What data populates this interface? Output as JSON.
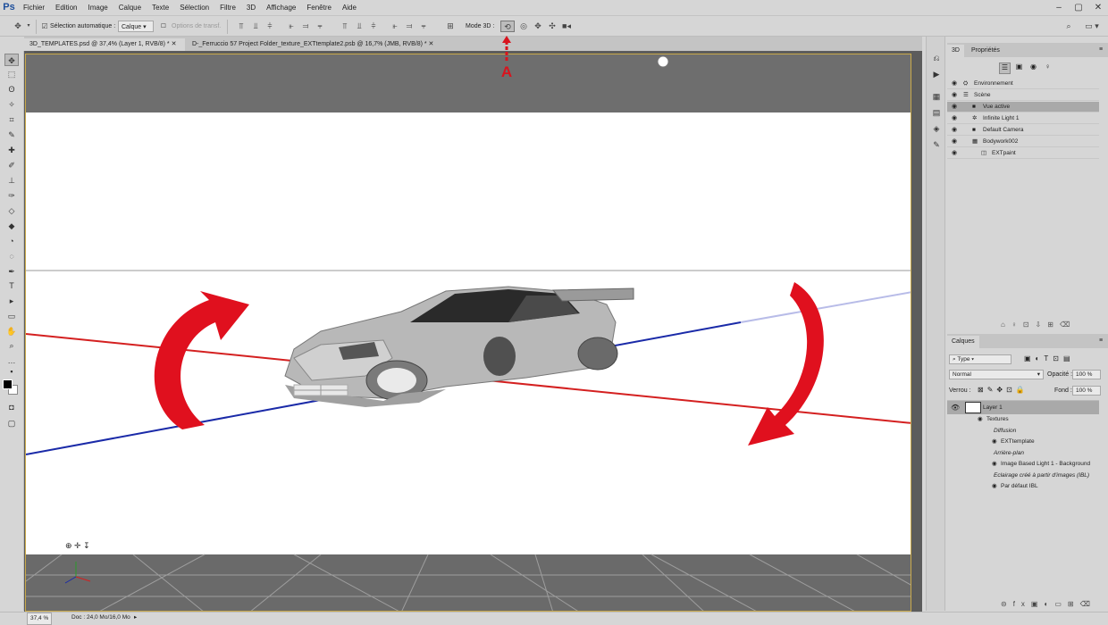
{
  "app": {
    "logo": "Ps"
  },
  "menu": [
    "Fichier",
    "Edition",
    "Image",
    "Calque",
    "Texte",
    "Sélection",
    "Filtre",
    "3D",
    "Affichage",
    "Fenêtre",
    "Aide"
  ],
  "options_bar": {
    "auto_select_label": "Sélection automatique :",
    "auto_select_value": "Calque",
    "transform_options": "Options de transf.",
    "mode3d_label": "Mode 3D :"
  },
  "tabs": [
    "3D_TEMPLATES.psd @ 37,4% (Layer 1, RVB/8) *",
    "D-_Ferruccio 57 Project Folder_texture_EXTtemplate2.psb @ 16,7% (JMB, RVB/8) *"
  ],
  "annotation": {
    "label": "A",
    "color": "#d8141e"
  },
  "colors": {
    "arrow": "#e0101e",
    "x_axis": "#d42020",
    "z_axis": "#1a2aa8"
  },
  "panel3d": {
    "tabs": [
      "3D",
      "Propriétés"
    ],
    "items": [
      {
        "label": "Environnement",
        "icon": "environment-icon",
        "indent": 0,
        "selected": false
      },
      {
        "label": "Scène",
        "icon": "scene-icon",
        "indent": 0,
        "selected": false
      },
      {
        "label": "Vue active",
        "icon": "camera-icon",
        "indent": 1,
        "selected": true
      },
      {
        "label": "Infinite Light 1",
        "icon": "light-icon",
        "indent": 1,
        "selected": false
      },
      {
        "label": "Default Camera",
        "icon": "camera-icon",
        "indent": 1,
        "selected": false
      },
      {
        "label": "Bodywork002",
        "icon": "mesh-icon",
        "indent": 1,
        "selected": false
      },
      {
        "label": "EXTpaint",
        "icon": "material-icon",
        "indent": 2,
        "selected": false
      }
    ]
  },
  "layers_panel": {
    "title": "Calques",
    "filter_type": "Type",
    "blend_mode": "Normal",
    "opacity_label": "Opacité :",
    "opacity_value": "100 %",
    "lock_label": "Verrou :",
    "fill_label": "Fond :",
    "fill_value": "100 %",
    "layer_name": "Layer 1",
    "sublayers": [
      {
        "text": "Textures",
        "eye": true,
        "italic": false,
        "indent": 0
      },
      {
        "text": "Diffusion",
        "eye": false,
        "italic": true,
        "indent": 1
      },
      {
        "text": "EXTtemplate",
        "eye": true,
        "italic": false,
        "indent": 2
      },
      {
        "text": "Arrière-plan",
        "eye": false,
        "italic": true,
        "indent": 1
      },
      {
        "text": "Image Based Light 1 - Background",
        "eye": true,
        "italic": false,
        "indent": 2
      },
      {
        "text": "Eclairage créé à partir d'images (IBL)",
        "eye": false,
        "italic": true,
        "indent": 1
      },
      {
        "text": "Par défaut IBL",
        "eye": true,
        "italic": false,
        "indent": 2
      }
    ]
  },
  "status": {
    "zoom": "37,4 %",
    "doc": "Doc : 24,0 Mo/16,0 Mo"
  }
}
